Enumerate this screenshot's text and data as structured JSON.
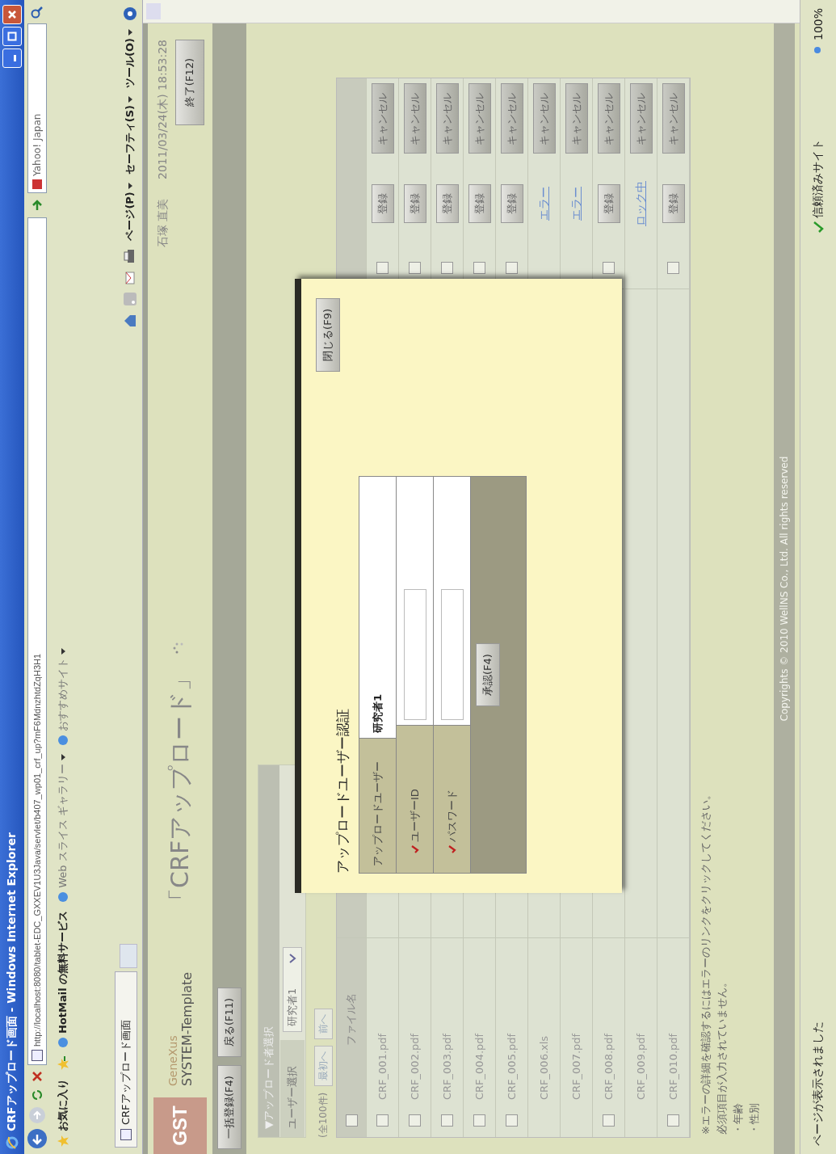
{
  "window": {
    "title": "CRFアップロード画面 - Windows Internet Explorer"
  },
  "address_bar": {
    "url": "http://localhost:8080/tablet-EDC_GXXEV1U3Java/servlet/b407_wp01_crf_up?mF6MdnzhtdZqH3H1",
    "search_placeholder": "Yahoo! Japan"
  },
  "favorites_bar": {
    "label": "お気に入り",
    "links": [
      {
        "label": "HotMail の無料サービス",
        "dropdown": false
      },
      {
        "label": "Web スライス ギャラリー",
        "dropdown": true
      },
      {
        "label": "おすすめサイト",
        "dropdown": true
      }
    ]
  },
  "tab": {
    "title": "CRFアップロード画面"
  },
  "command_bar": {
    "menus": [
      "ページ(P)",
      "セーフティ(S)",
      "ツール(O)"
    ]
  },
  "header": {
    "logo": "GST",
    "brand": "GeneXus",
    "system": "SYSTEM-Template",
    "title": "「CRFアップロード」",
    "user": "石塚 直美",
    "datetime": "2011/03/24(木) 18:53:28",
    "exit_button": "終了(F12)"
  },
  "toolbar": {
    "buttons": [
      "一括登録(F4)",
      "戻る(F11)"
    ]
  },
  "uploader_section": {
    "title": "▼アップロード者選択",
    "user_label": "ユーザー選択",
    "user_value": "研究者1"
  },
  "pager": {
    "count": "(全100件)",
    "buttons": [
      "最初へ",
      "前へ"
    ]
  },
  "table": {
    "columns": [
      "ファイル名"
    ],
    "select_all": false,
    "rows": [
      {
        "file": "CRF_001.pdf",
        "selectable": true,
        "action": {
          "kind": "button",
          "label": "登録"
        },
        "cancel": "キャンセル"
      },
      {
        "file": "CRF_002.pdf",
        "selectable": true,
        "action": {
          "kind": "button",
          "label": "登録"
        },
        "cancel": "キャンセル"
      },
      {
        "file": "CRF_003.pdf",
        "selectable": true,
        "action": {
          "kind": "button",
          "label": "登録"
        },
        "cancel": "キャンセル"
      },
      {
        "file": "CRF_004.pdf",
        "selectable": true,
        "action": {
          "kind": "button",
          "label": "登録"
        },
        "cancel": "キャンセル"
      },
      {
        "file": "CRF_005.pdf",
        "selectable": true,
        "action": {
          "kind": "button",
          "label": "登録"
        },
        "cancel": "キャンセル"
      },
      {
        "file": "CRF_006.xls",
        "selectable": false,
        "action": {
          "kind": "link",
          "label": "エラー"
        },
        "cancel": "キャンセル"
      },
      {
        "file": "CRF_007.pdf",
        "selectable": false,
        "action": {
          "kind": "link",
          "label": "エラー"
        },
        "cancel": "キャンセル"
      },
      {
        "file": "CRF_008.pdf",
        "selectable": true,
        "action": {
          "kind": "button",
          "label": "登録"
        },
        "cancel": "キャンセル"
      },
      {
        "file": "CRF_009.pdf",
        "selectable": false,
        "action": {
          "kind": "link",
          "label": "ロック中"
        },
        "cancel": "キャンセル"
      },
      {
        "file": "CRF_010.pdf",
        "selectable": true,
        "action": {
          "kind": "button",
          "label": "登録"
        },
        "cancel": "キャンセル"
      }
    ]
  },
  "notes": [
    "※エラーの詳細を確認するにはエラーのリンクをクリックしてください。",
    "必須項目が入力されていません。",
    "・年齢",
    "・性別"
  ],
  "copyright": "Copyrights © 2010 WellNS Co., Ltd. All rights reserved",
  "dialog": {
    "title": "アップロードユーザー認証",
    "close_button": "閉じる(F9)",
    "fields": [
      {
        "label": "アップロードユーザー",
        "kind": "text",
        "value": "研究者1"
      },
      {
        "label": "ユーザーID",
        "kind": "input",
        "required": true
      },
      {
        "label": "パスワード",
        "kind": "input",
        "required": true
      }
    ],
    "submit_button": "承認(F4)"
  },
  "status_bar": {
    "message": "ページが表示されました",
    "zone": "信頼済みサイト",
    "zoom": "100%"
  }
}
